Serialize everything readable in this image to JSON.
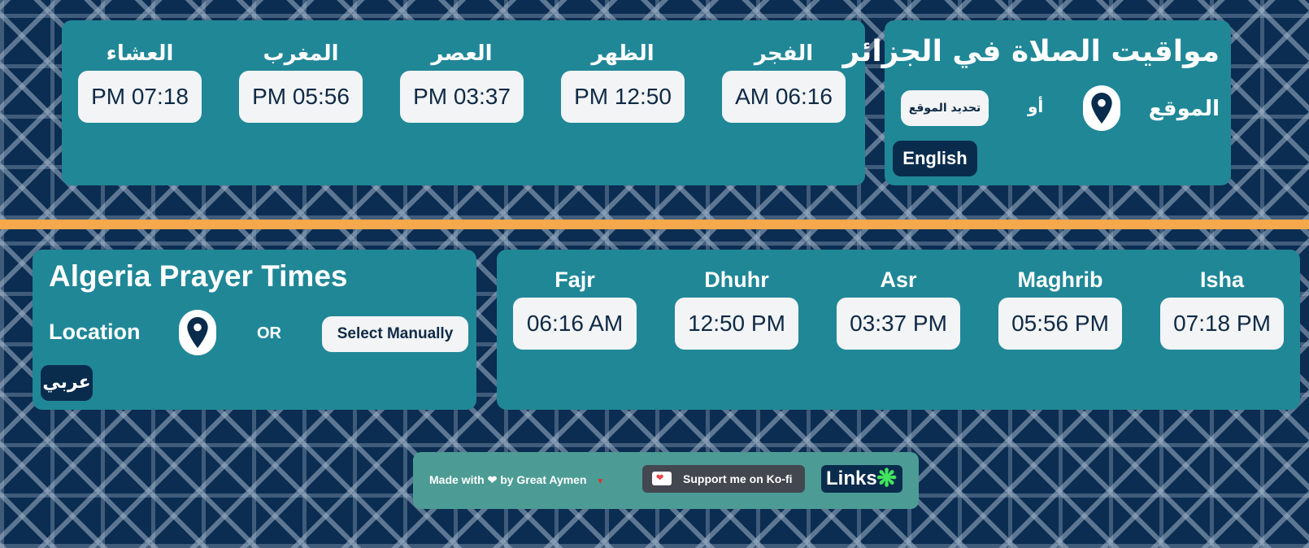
{
  "ar": {
    "title": "مواقيت الصلاة في الجزائر",
    "location_label": "الموقع",
    "or_label": "أو",
    "manual_button": "تحديد الموقع",
    "language_button": "English",
    "prayers": [
      {
        "name": "الفجر",
        "time": "AM 06:16"
      },
      {
        "name": "الظهر",
        "time": "PM 12:50"
      },
      {
        "name": "العصر",
        "time": "PM 03:37"
      },
      {
        "name": "المغرب",
        "time": "PM 05:56"
      },
      {
        "name": "العشاء",
        "time": "PM 07:18"
      }
    ]
  },
  "en": {
    "title": "Algeria Prayer Times",
    "location_label": "Location",
    "or_label": "OR",
    "manual_button": "Select Manually",
    "language_button": "عربي",
    "prayers": [
      {
        "name": "Fajr",
        "time": "06:16 AM"
      },
      {
        "name": "Dhuhr",
        "time": "12:50 PM"
      },
      {
        "name": "Asr",
        "time": "03:37 PM"
      },
      {
        "name": "Maghrib",
        "time": "05:56 PM"
      },
      {
        "name": "Isha",
        "time": "07:18 PM"
      }
    ]
  },
  "footer": {
    "made_with": "Made with",
    "by": "by Great Aymen",
    "kofi": "Support me on Ko-fi",
    "links": "Links"
  },
  "icons": {
    "location": "map-pin-icon",
    "heart": "heart-icon",
    "kofi": "ko-fi-cup-icon",
    "links": "linktree-asterisk-icon"
  },
  "colors": {
    "panel": "#208797",
    "divider": "#f6a94c",
    "dark_button": "#0a2c4c",
    "footer": "#4c9c95",
    "kofi_button": "#434750"
  }
}
